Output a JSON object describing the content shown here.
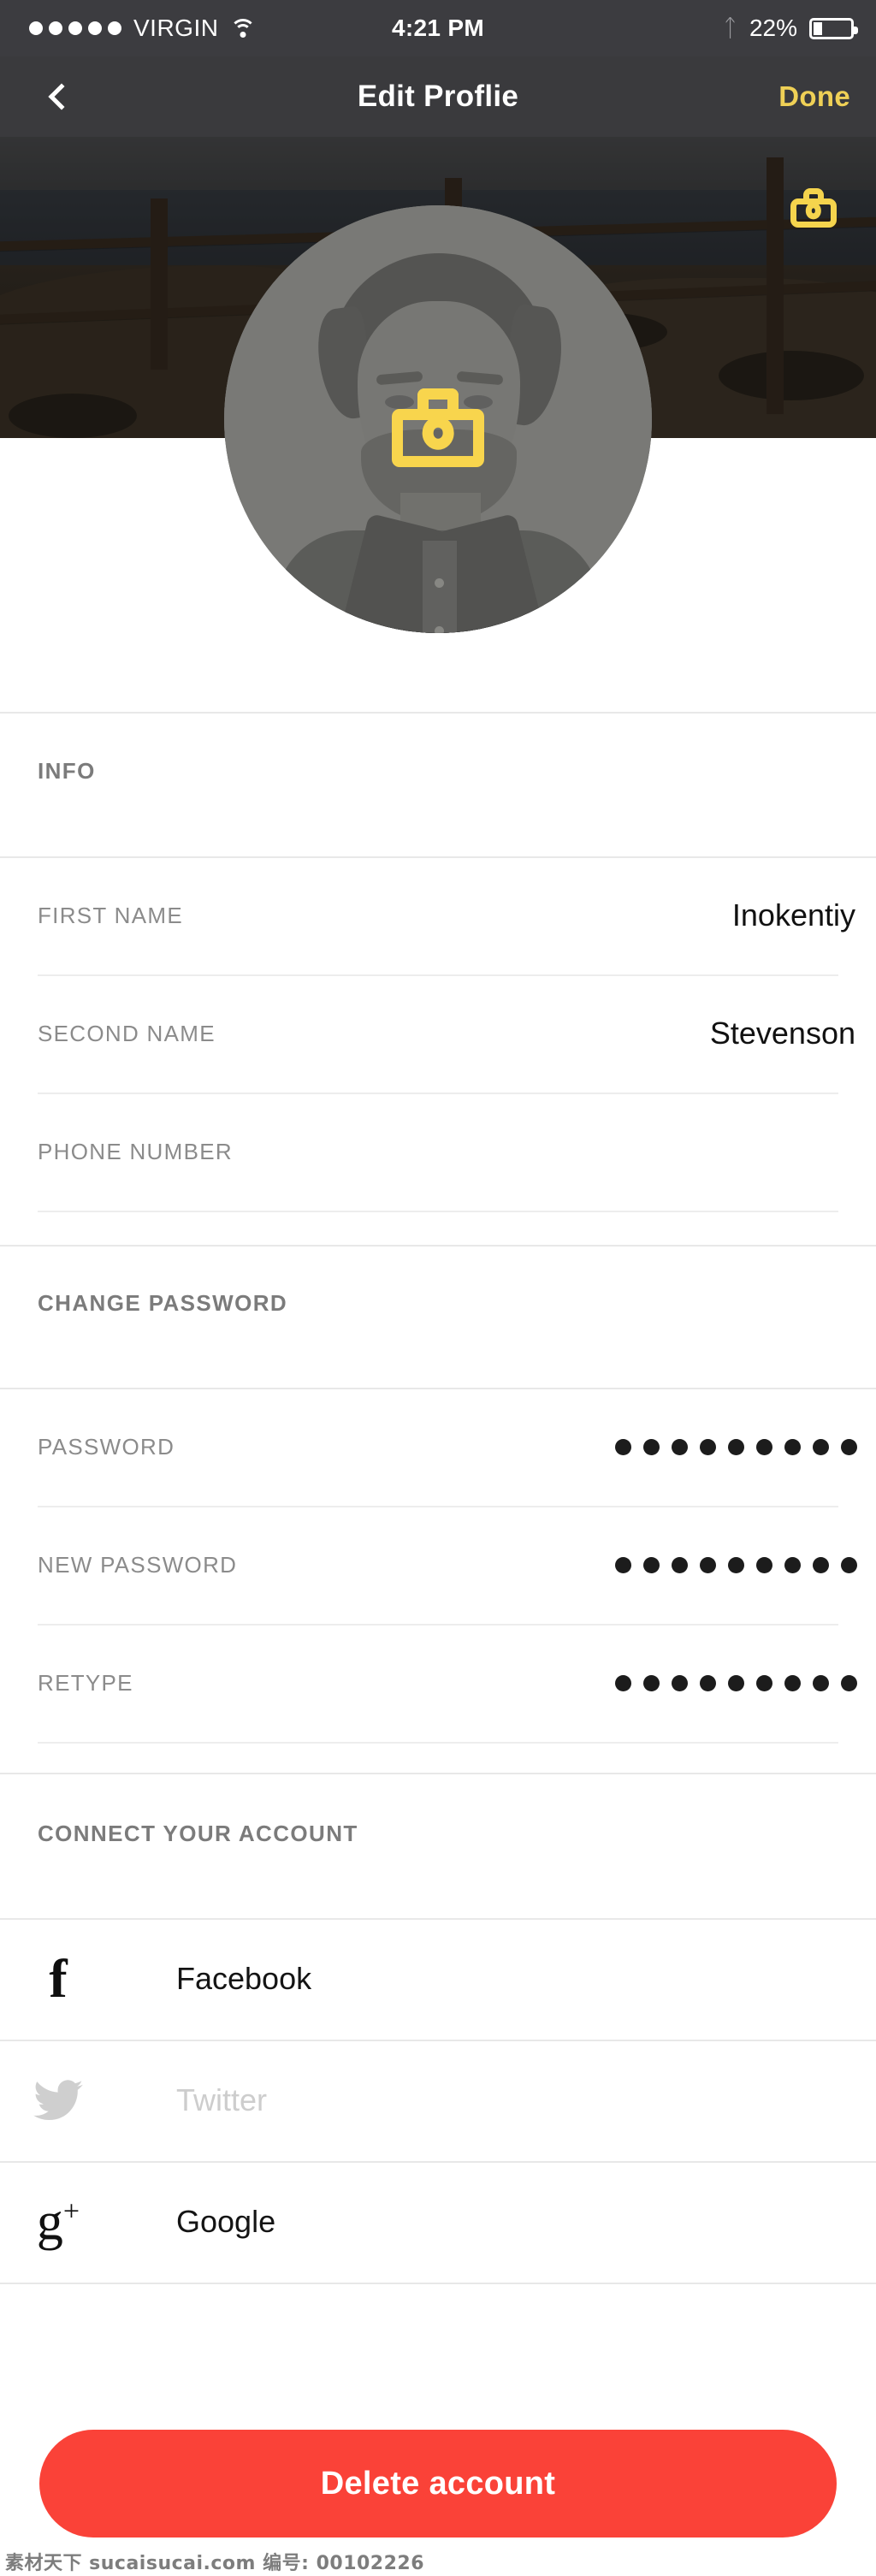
{
  "status_bar": {
    "signal_dots": 5,
    "carrier": "VIRGIN",
    "wifi_icon": "wifi-icon",
    "time": "4:21 PM",
    "bluetooth_icon": "bluetooth-icon",
    "battery_percent": "22%",
    "battery_level": 22
  },
  "nav_bar": {
    "back_icon": "chevron-left-icon",
    "title": "Edit Proflie",
    "done_label": "Done",
    "done_color": "#EFD056"
  },
  "cover": {
    "change_cover_icon": "camera-icon"
  },
  "avatar": {
    "change_photo_icon": "camera-icon"
  },
  "info_section": {
    "header": "INFO",
    "rows": [
      {
        "label": "FIRST NAME",
        "value": "Inokentiy",
        "placeholder": "First name"
      },
      {
        "label": "SECOND NAME",
        "value": "Stevenson",
        "placeholder": "Second name"
      },
      {
        "label": "PHONE NUMBER",
        "value": "",
        "placeholder": ""
      }
    ]
  },
  "password_section": {
    "header": "CHANGE PASSWORD",
    "rows": [
      {
        "label": "PASSWORD",
        "masked_length": 9
      },
      {
        "label": "NEW PASSWORD",
        "masked_length": 9
      },
      {
        "label": "RETYPE",
        "masked_length": 9
      }
    ]
  },
  "connect_section": {
    "header": "CONNECT YOUR ACCOUNT",
    "accounts": [
      {
        "label": "Facebook",
        "icon": "facebook-icon",
        "connected": true
      },
      {
        "label": "Twitter",
        "icon": "twitter-icon",
        "connected": false
      },
      {
        "label": "Google",
        "icon": "google-plus-icon",
        "connected": true
      }
    ]
  },
  "delete": {
    "label": "Delete account",
    "color": "#FA4238"
  },
  "watermark": {
    "text": "素材天下 sucaisucai.com 编号: 00102226"
  }
}
